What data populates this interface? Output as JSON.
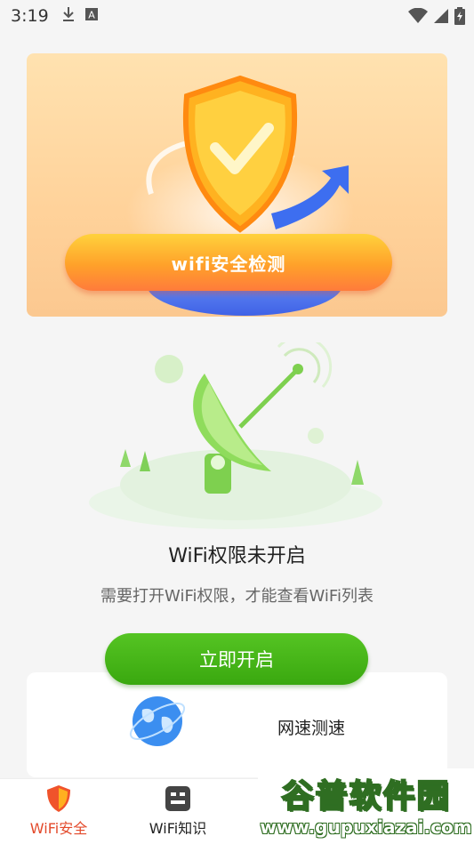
{
  "status_bar": {
    "time": "3:19",
    "icons": [
      "download-icon",
      "a-icon",
      "wifi-icon",
      "signal-icon",
      "battery-icon"
    ]
  },
  "hero": {
    "button_label": "wifi安全检测",
    "accent_colors": [
      "#ffd23c",
      "#ff7b3b"
    ]
  },
  "permission": {
    "title": "WiFi权限未开启",
    "description": "需要打开WiFi权限，才能查看WiFi列表",
    "open_button": "立即开启"
  },
  "speed_card": {
    "label": "网速测速"
  },
  "bottom_nav": {
    "items": [
      {
        "label": "WiFi安全",
        "icon": "shield-icon",
        "active": true
      },
      {
        "label": "WiFi知识",
        "icon": "document-icon",
        "active": false
      }
    ]
  },
  "watermark": {
    "main": "谷普软件园",
    "sub": "www.gupuxiazai.com"
  },
  "colors": {
    "accent_green": "#46b619",
    "accent_orange": "#ff9a2b",
    "active_nav": "#e34a2b"
  }
}
